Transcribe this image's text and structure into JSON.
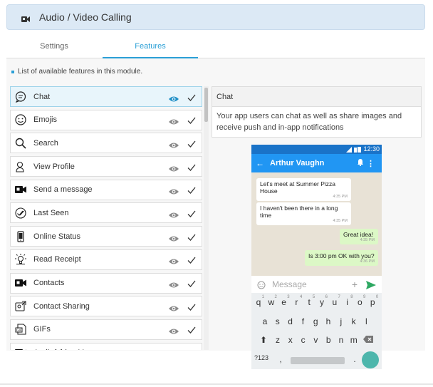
{
  "header": {
    "title": "Audio / Video Calling",
    "icon": "video-camera-icon"
  },
  "tabs": [
    {
      "label": "Settings",
      "active": false
    },
    {
      "label": "Features",
      "active": true
    }
  ],
  "info_text": "List of available features in this module.",
  "features": [
    {
      "label": "Chat",
      "icon": "chat-bubble-icon",
      "active": true
    },
    {
      "label": "Emojis",
      "icon": "smiley-icon",
      "active": false
    },
    {
      "label": "Search",
      "icon": "magnifier-icon",
      "active": false
    },
    {
      "label": "View Profile",
      "icon": "user-profile-icon",
      "active": false
    },
    {
      "label": "Send a message",
      "icon": "video-camera-icon",
      "active": false
    },
    {
      "label": "Last Seen",
      "icon": "double-check-icon",
      "active": false
    },
    {
      "label": "Online Status",
      "icon": "phone-icon",
      "active": false
    },
    {
      "label": "Read Receipt",
      "icon": "lightbulb-icon",
      "active": false
    },
    {
      "label": "Contacts",
      "icon": "video-camera-icon",
      "active": false
    },
    {
      "label": "Contact Sharing",
      "icon": "share-contact-icon",
      "active": false
    },
    {
      "label": "GIFs",
      "icon": "gif-icon",
      "active": false
    },
    {
      "label": "Audio/Video M...",
      "icon": "video-camera-icon",
      "active": false
    }
  ],
  "detail": {
    "title": "Chat",
    "description": "Your app users can chat as well as share images and receive push and in-app notifications"
  },
  "phone": {
    "status_time": "12:30",
    "contact_name": "Arthur Vaughn",
    "messages": [
      {
        "text": "Let's meet at Summer Pizza House",
        "time": "4:35 PM",
        "direction": "in"
      },
      {
        "text": "I haven't been there in a long time",
        "time": "4:35 PM",
        "direction": "in"
      },
      {
        "text": "Great idea!",
        "time": "4:35 PM",
        "direction": "out"
      },
      {
        "text": "Is 3:00 pm OK with you?",
        "time": "4:36 PM",
        "direction": "out"
      }
    ],
    "input_placeholder": "Message",
    "keyboard": {
      "row1": [
        "q",
        "w",
        "e",
        "r",
        "t",
        "y",
        "u",
        "i",
        "o",
        "p"
      ],
      "row1_sup": [
        "1",
        "2",
        "3",
        "4",
        "5",
        "6",
        "7",
        "8",
        "9",
        "0"
      ],
      "row2": [
        "a",
        "s",
        "d",
        "f",
        "g",
        "h",
        "j",
        "k",
        "l"
      ],
      "row3": [
        "z",
        "x",
        "c",
        "v",
        "b",
        "n",
        "m"
      ],
      "symbols_key": "?123",
      "comma_key": ",",
      "period_key": "."
    }
  },
  "colors": {
    "accent": "#2a9fd6",
    "header_bg": "#dce9f5",
    "appbar": "#2196f3",
    "bubble_out": "#dcf8c6"
  }
}
